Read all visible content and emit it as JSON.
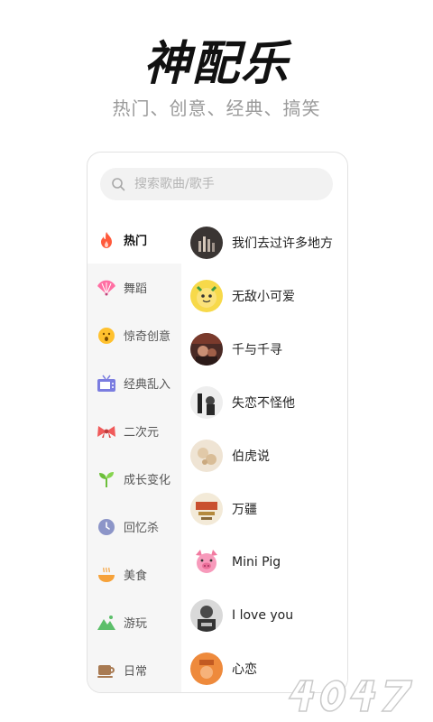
{
  "header": {
    "title": "神配乐",
    "subtitle": "热门、创意、经典、搞笑"
  },
  "search": {
    "placeholder": "搜索歌曲/歌手"
  },
  "categories": [
    {
      "label": "热门",
      "icon": "fire-icon",
      "active": true
    },
    {
      "label": "舞蹈",
      "icon": "fan-icon"
    },
    {
      "label": "惊奇创意",
      "icon": "surprised-face-icon"
    },
    {
      "label": "经典乱入",
      "icon": "tv-icon"
    },
    {
      "label": "二次元",
      "icon": "bow-icon"
    },
    {
      "label": "成长变化",
      "icon": "sprout-icon"
    },
    {
      "label": "回忆杀",
      "icon": "clock-icon"
    },
    {
      "label": "美食",
      "icon": "bowl-icon"
    },
    {
      "label": "游玩",
      "icon": "mountain-icon"
    },
    {
      "label": "日常",
      "icon": "coffee-cup-icon"
    }
  ],
  "songs": [
    {
      "title": "我们去过许多地方"
    },
    {
      "title": "无敌小可爱"
    },
    {
      "title": "千与千寻"
    },
    {
      "title": "失恋不怪他"
    },
    {
      "title": "伯虎说"
    },
    {
      "title": "万疆"
    },
    {
      "title": "Mini Pig"
    },
    {
      "title": "I love you"
    },
    {
      "title": "心恋"
    }
  ],
  "colors": {
    "accent": "#ff5a3c",
    "sidebar_bg": "#f6f6f6",
    "subtitle": "#9a9a9a"
  }
}
